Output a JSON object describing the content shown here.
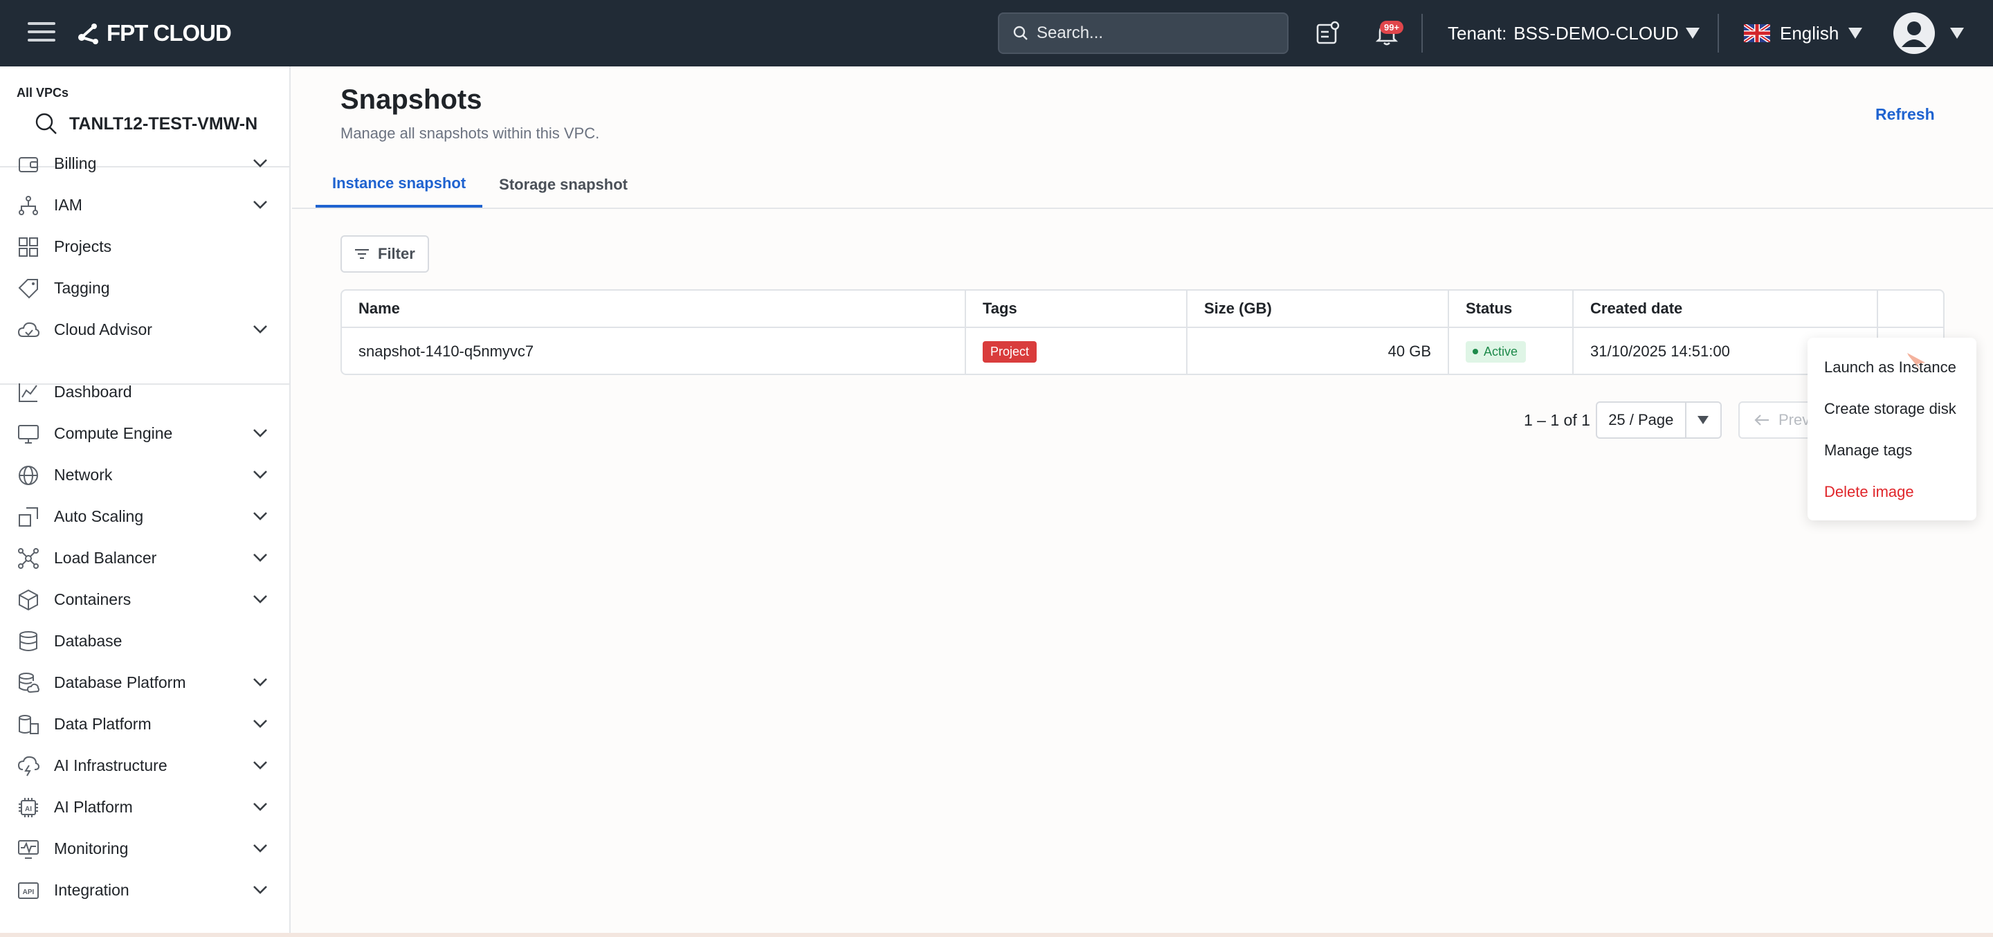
{
  "topbar": {
    "brand": "FPT CLOUD",
    "search_placeholder": "Search...",
    "notification_badge": "99+",
    "tenant_label": "Tenant:",
    "tenant_value": "BSS-DEMO-CLOUD",
    "language": "English"
  },
  "sidebar": {
    "vpc_label": "All VPCs",
    "vpc_name": "TANLT12-TEST-VMW-N",
    "items": [
      {
        "label": "Billing",
        "icon": "wallet-icon",
        "expandable": true
      },
      {
        "label": "IAM",
        "icon": "hierarchy-icon",
        "expandable": true
      },
      {
        "label": "Projects",
        "icon": "grid-icon",
        "expandable": false
      },
      {
        "label": "Tagging",
        "icon": "tag-icon",
        "expandable": false
      },
      {
        "label": "Cloud Advisor",
        "icon": "cloud-check-icon",
        "expandable": true
      },
      {
        "label": "Dashboard",
        "icon": "chart-line-icon",
        "expandable": false
      },
      {
        "label": "Compute Engine",
        "icon": "monitor-icon",
        "expandable": true
      },
      {
        "label": "Network",
        "icon": "globe-icon",
        "expandable": true
      },
      {
        "label": "Auto Scaling",
        "icon": "scaling-icon",
        "expandable": true
      },
      {
        "label": "Load Balancer",
        "icon": "network-nodes-icon",
        "expandable": true
      },
      {
        "label": "Containers",
        "icon": "cube-icon",
        "expandable": true
      },
      {
        "label": "Database",
        "icon": "database-icon",
        "expandable": false
      },
      {
        "label": "Database Platform",
        "icon": "database-cloud-icon",
        "expandable": true
      },
      {
        "label": "Data Platform",
        "icon": "data-stack-icon",
        "expandable": true
      },
      {
        "label": "AI Infrastructure",
        "icon": "cloud-bolt-icon",
        "expandable": true
      },
      {
        "label": "AI Platform",
        "icon": "ai-chip-icon",
        "expandable": true
      },
      {
        "label": "Monitoring",
        "icon": "pulse-monitor-icon",
        "expandable": true
      },
      {
        "label": "Integration",
        "icon": "api-icon",
        "expandable": true
      }
    ]
  },
  "main": {
    "title": "Snapshots",
    "subtitle": "Manage all snapshots within this VPC.",
    "refresh_label": "Refresh",
    "tabs": [
      {
        "label": "Instance snapshot",
        "active": true
      },
      {
        "label": "Storage snapshot",
        "active": false
      }
    ],
    "filter_label": "Filter",
    "table": {
      "columns": [
        "Name",
        "Tags",
        "Size (GB)",
        "Status",
        "Created date"
      ],
      "rows": [
        {
          "name": "snapshot-1410-q5nmyvc7",
          "tag": "Project",
          "size": "40 GB",
          "status": "Active",
          "created": "31/10/2025 14:51:00"
        }
      ]
    },
    "pagination": {
      "range_text": "1 – 1 of 1",
      "page_size": "25 / Page",
      "prev_label": "Prev"
    }
  },
  "context_menu": {
    "items": [
      {
        "label": "Launch as Instance",
        "danger": false
      },
      {
        "label": "Create storage disk",
        "danger": false
      },
      {
        "label": "Manage tags",
        "danger": false
      },
      {
        "label": "Delete image",
        "danger": true
      }
    ]
  },
  "colors": {
    "topbar_bg": "#212b36",
    "accent": "#1f63d0",
    "danger": "#e0262b",
    "tag_project": "#d93c3c",
    "status_active_bg": "#dff5e6",
    "status_active_fg": "#1e8a4b"
  }
}
